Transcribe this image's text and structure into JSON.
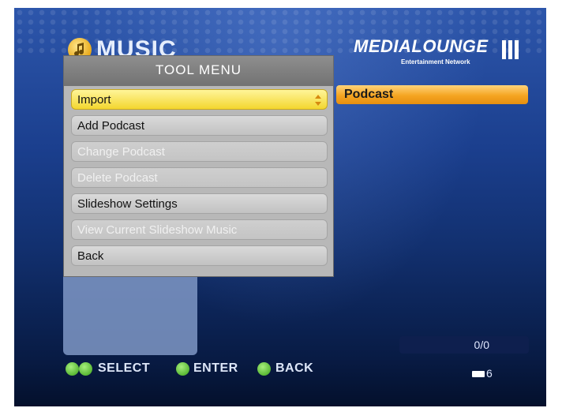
{
  "header": {
    "section_title": "MUSIC",
    "logo_text": "MEDIALOUNGE",
    "logo_subtitle": "Entertainment Network"
  },
  "list": {
    "selected_item": "Podcast"
  },
  "tool_menu": {
    "title": "TOOL MENU",
    "items": [
      {
        "label": "Import",
        "enabled": true,
        "selected": true
      },
      {
        "label": "Add Podcast",
        "enabled": true,
        "selected": false
      },
      {
        "label": "Change Podcast",
        "enabled": false,
        "selected": false
      },
      {
        "label": "Delete Podcast",
        "enabled": false,
        "selected": false
      },
      {
        "label": "Slideshow Settings",
        "enabled": true,
        "selected": false
      },
      {
        "label": "View Current Slideshow Music",
        "enabled": false,
        "selected": false
      },
      {
        "label": "Back",
        "enabled": true,
        "selected": false
      }
    ]
  },
  "status": {
    "position": "0/0",
    "count": "6"
  },
  "help_bar": {
    "select_label": "SELECT",
    "enter_label": "ENTER",
    "back_label": "BACK"
  },
  "colors": {
    "background": "#1b3f8e",
    "highlight_bar": "#f5a521",
    "selected_menu_item": "#f3d62f",
    "button_icon": "#3aa218"
  },
  "icons": {
    "section": "music-note-icon",
    "select": "up-down-arrows-icon",
    "enter": "enter-button-icon",
    "back": "back-arrow-icon",
    "count": "memory-card-icon"
  }
}
